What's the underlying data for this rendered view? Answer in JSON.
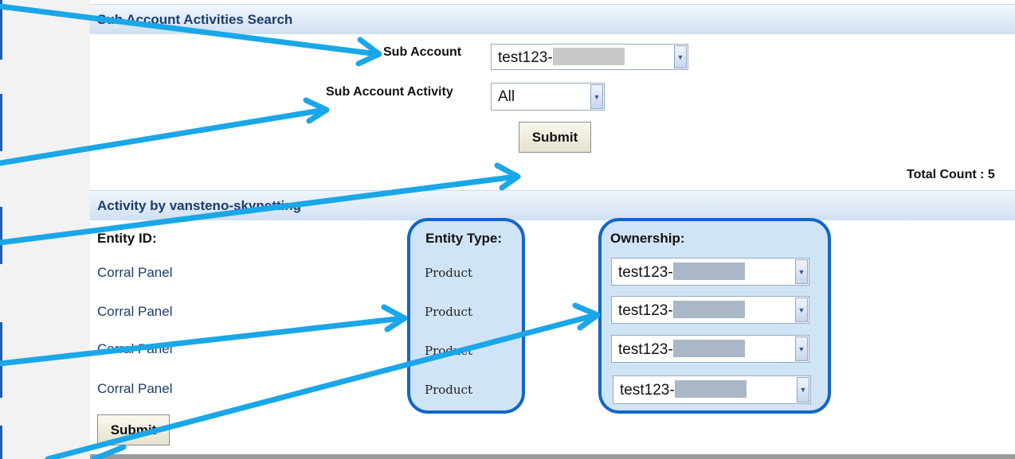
{
  "search_section": {
    "title": "Sub Account Activities Search",
    "sub_account_label": "Sub Account",
    "sub_account_value": "test123-",
    "activity_label": "Sub Account Activity",
    "activity_value": "All",
    "submit_label": "Submit",
    "total_count": "Total Count : 5"
  },
  "activity_section": {
    "title": "Activity by vansteno-skynetting",
    "col_entity_id": "Entity ID:",
    "col_entity_type": "Entity Type:",
    "col_ownership": "Ownership:",
    "rows": [
      {
        "entity_id": "Corral Panel",
        "entity_type": "Product",
        "ownership": "test123-"
      },
      {
        "entity_id": "Corral Panel",
        "entity_type": "Product",
        "ownership": "test123-"
      },
      {
        "entity_id": "Corral Panel",
        "entity_type": "Product",
        "ownership": "test123-"
      },
      {
        "entity_id": "Corral Panel",
        "entity_type": "Product",
        "ownership": "test123-"
      }
    ],
    "submit_label": "Submit"
  },
  "annotation": {
    "arrow_color": "#1aa7e8",
    "highlight_border": "#1266c8"
  }
}
